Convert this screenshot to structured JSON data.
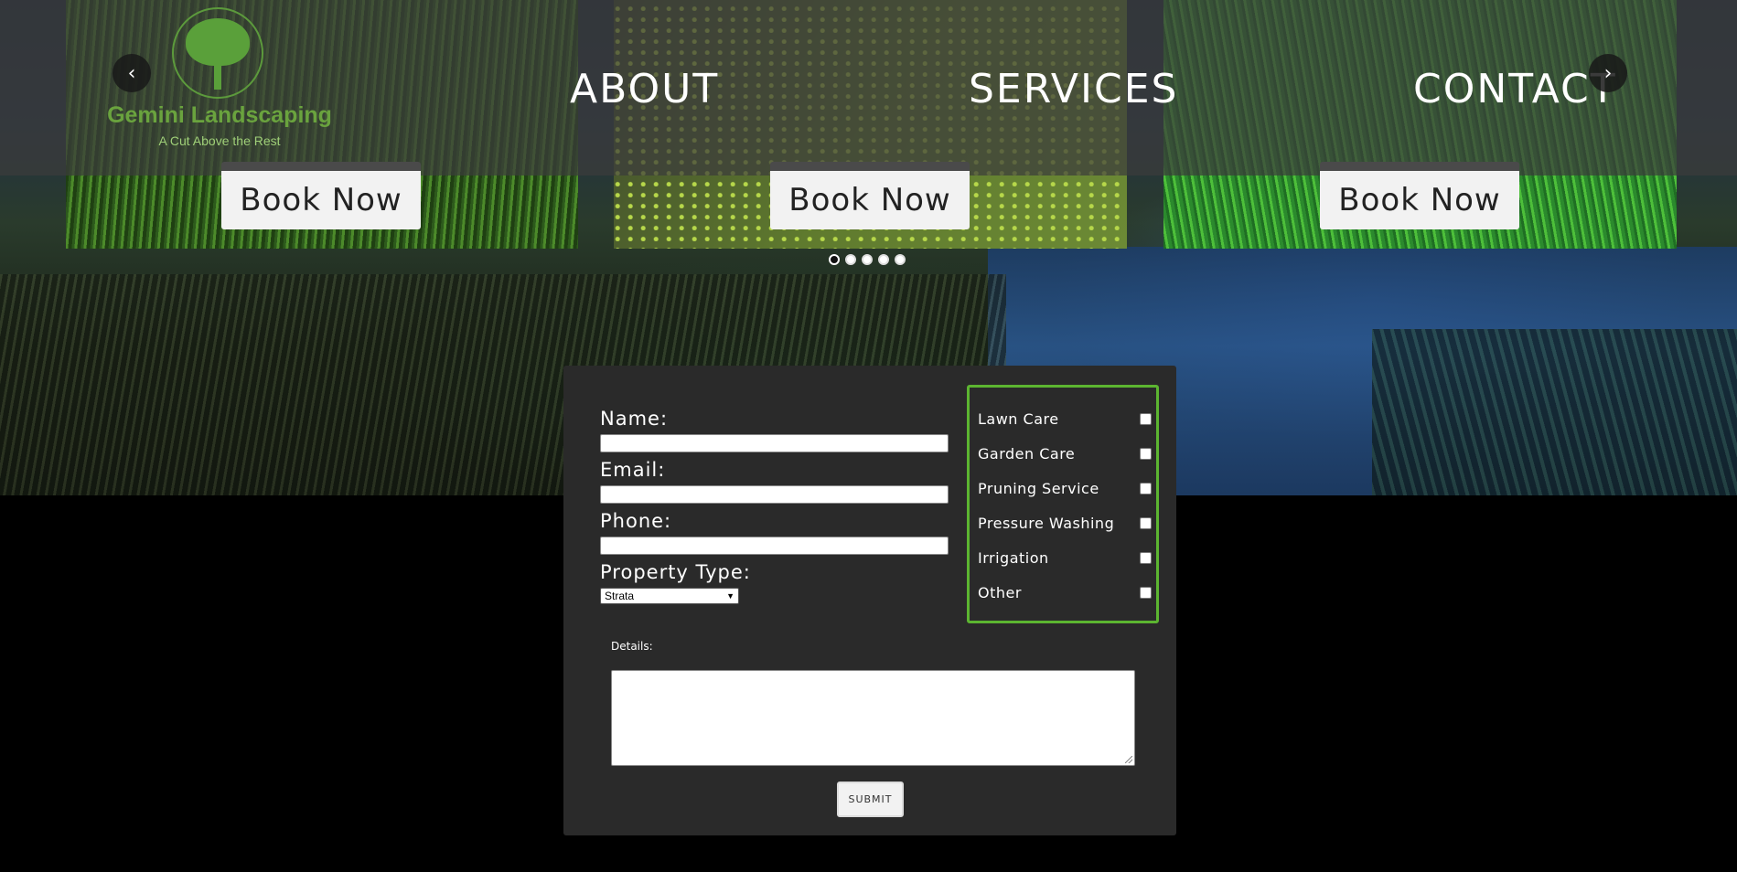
{
  "header": {
    "brand_name": "Gemini Landscaping",
    "tagline": "A Cut Above the Rest",
    "nav": [
      "ABOUT",
      "SERVICES",
      "CONTACT"
    ]
  },
  "carousel": {
    "prev_icon": "chevron-left-icon",
    "next_icon": "chevron-right-icon",
    "prev_glyph": "‹",
    "next_glyph": "›",
    "book_label": "Book Now",
    "slide_count": 5,
    "active_slide": 1
  },
  "form": {
    "name_label": "Name:",
    "email_label": "Email:",
    "phone_label": "Phone:",
    "property_type_label": "Property Type:",
    "property_type_value": "Strata",
    "services": [
      {
        "label": "Lawn Care",
        "checked": false
      },
      {
        "label": "Garden Care",
        "checked": false
      },
      {
        "label": "Pruning Service",
        "checked": false
      },
      {
        "label": "Pressure Washing",
        "checked": false
      },
      {
        "label": "Irrigation",
        "checked": false
      },
      {
        "label": "Other",
        "checked": false
      }
    ],
    "details_label": "Details:",
    "submit_label": "SUBMIT"
  },
  "colors": {
    "brand_green": "#6aa33e",
    "services_border": "#5cb531",
    "card_bg": "#2a2a2a"
  }
}
